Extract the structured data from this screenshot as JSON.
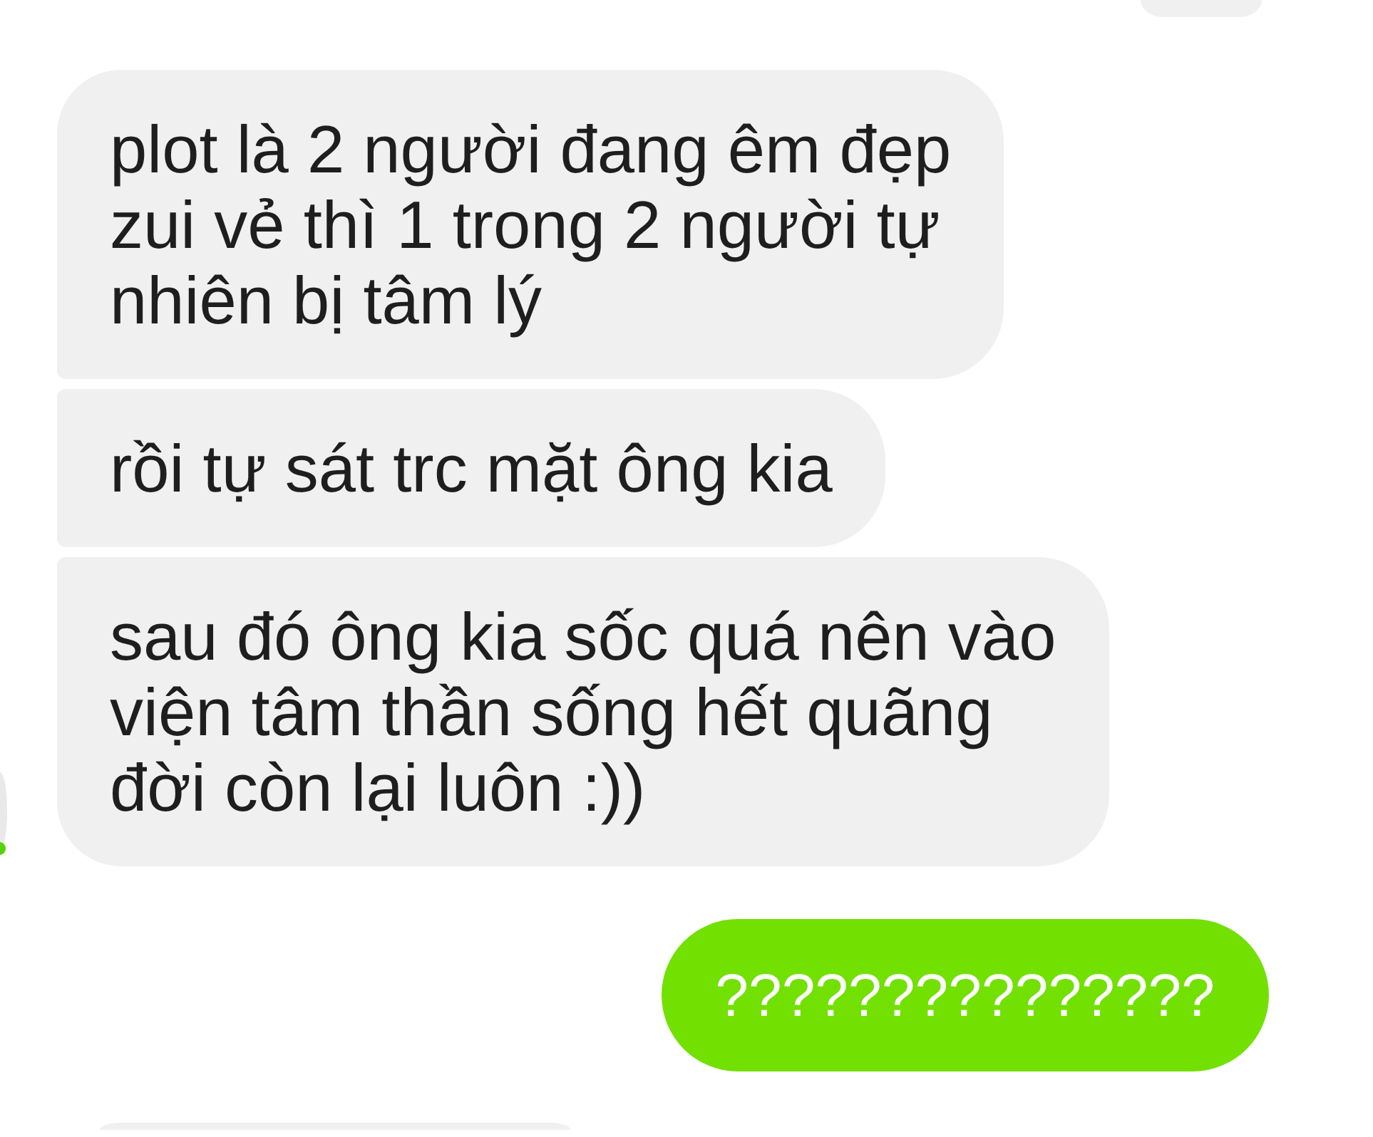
{
  "conversation": {
    "top_cutoff": {
      "kind": "right"
    },
    "messages": [
      {
        "kind": "received",
        "text": "plot là 2 người đang êm đẹp\nzui vẻ thì 1 trong 2 người tự\nnhiên bị tâm lý"
      },
      {
        "kind": "received",
        "text": "rồi tự sát trc mặt ông kia"
      },
      {
        "kind": "received",
        "text": "sau đó ông kia sốc quá nên vào\nviện tâm thần sống hết quãng\nđời còn lại luôn :))"
      },
      {
        "kind": "sent",
        "text": "???????????????"
      }
    ],
    "bottom_cutoff": {
      "kind": "left"
    }
  },
  "contact": {
    "online": true
  }
}
